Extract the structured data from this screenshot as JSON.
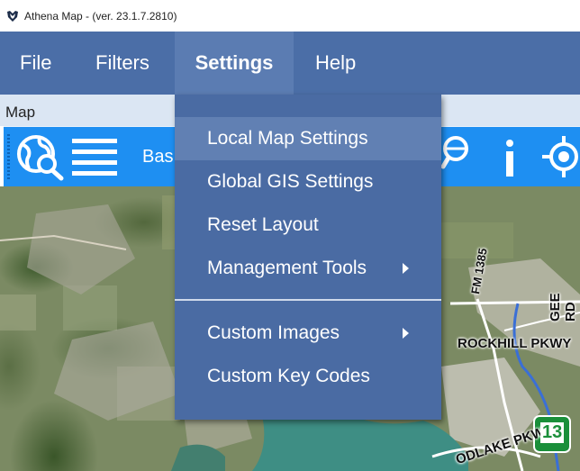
{
  "window": {
    "title": "Athena Map - (ver. 23.1.7.2810)",
    "icon": "athena-logo-icon"
  },
  "menubar": {
    "items": [
      {
        "label": "File"
      },
      {
        "label": "Filters"
      },
      {
        "label": "Settings",
        "active": true
      },
      {
        "label": "Help"
      }
    ]
  },
  "panel": {
    "title": "Map"
  },
  "toolbar": {
    "icons": [
      "globe-search-icon",
      "list-icon",
      "magnifier-icon",
      "info-icon",
      "crosshair-icon"
    ],
    "basemap_label": "Bas"
  },
  "settings_menu": {
    "items": [
      {
        "label": "Local Map Settings",
        "highlighted": true
      },
      {
        "label": "Global GIS Settings"
      },
      {
        "label": "Reset Layout"
      },
      {
        "label": "Management Tools",
        "submenu": true
      },
      {
        "label": "Custom Images",
        "submenu": true
      },
      {
        "label": "Custom Key Codes"
      }
    ]
  },
  "map": {
    "labels": [
      "FM 1385",
      "GEE RD",
      "ROCKHILL PKWY",
      "ODLAKE PKWY",
      "13"
    ]
  },
  "colors": {
    "menubar": "#4b6ea7",
    "dropdown": "#4a6ba3",
    "dropdown_hover": "#6180b3",
    "toolbar": "#1e8ff2",
    "panel_title": "#dbe6f3"
  }
}
